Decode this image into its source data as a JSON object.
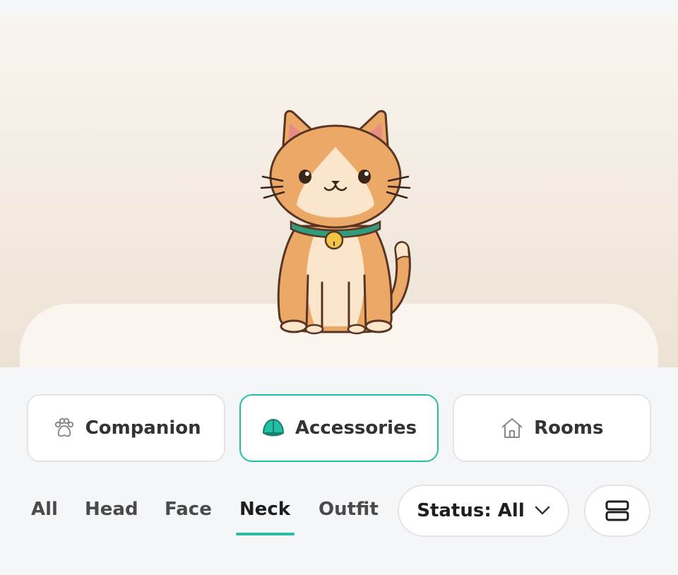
{
  "main_tabs": [
    {
      "label": "Companion",
      "icon": "paw-icon"
    },
    {
      "label": "Accessories",
      "icon": "cap-icon",
      "active": true
    },
    {
      "label": "Rooms",
      "icon": "house-icon"
    }
  ],
  "sub_tabs": [
    {
      "label": "All"
    },
    {
      "label": "Head"
    },
    {
      "label": "Face"
    },
    {
      "label": "Neck",
      "active": true
    },
    {
      "label": "Outfit"
    }
  ],
  "status_filter": {
    "label": "Status: All",
    "icon": "chevron-down-icon"
  },
  "layout_toggle": {
    "icon": "list-layout-icon"
  },
  "colors": {
    "accent": "#22bfa6",
    "cat_orange": "#eba866",
    "collar": "#2f9c7c",
    "bell": "#f0c544"
  }
}
